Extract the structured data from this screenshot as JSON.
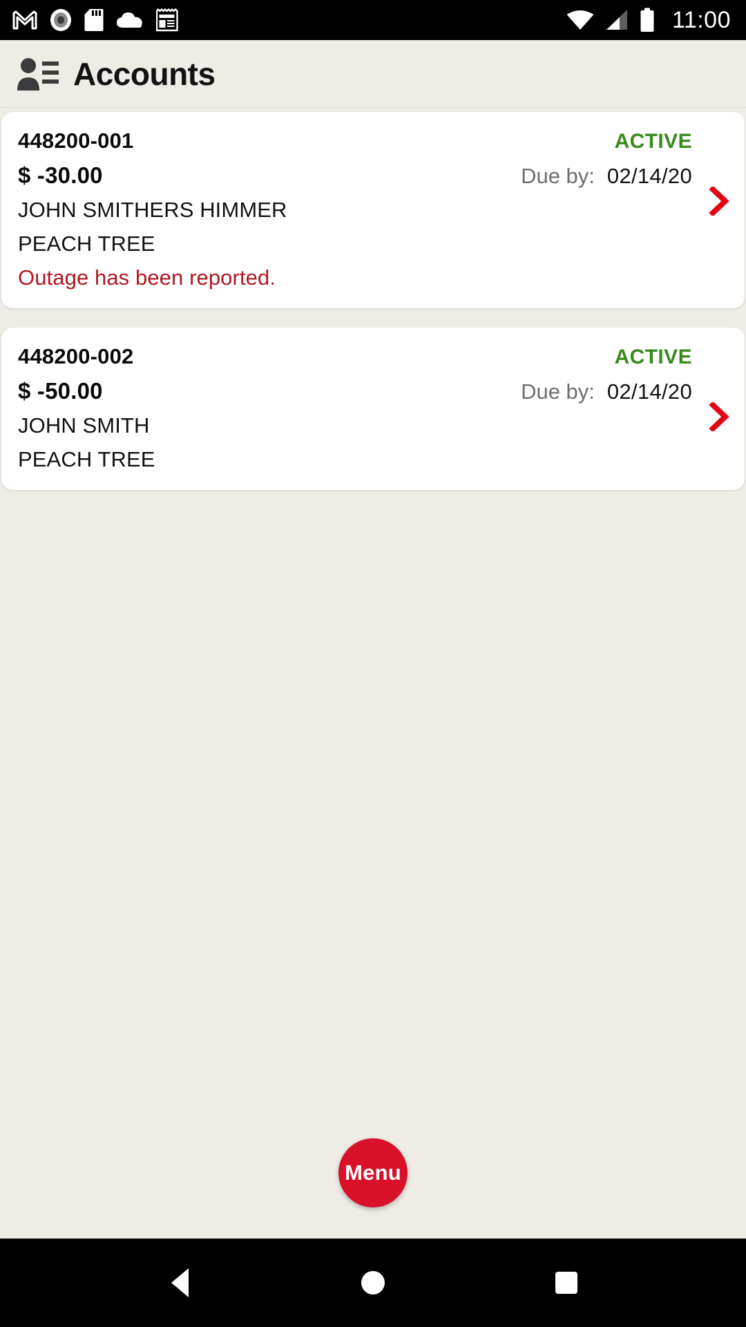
{
  "status_bar": {
    "left_icons": [
      {
        "name": "gmail-icon",
        "label": "M"
      },
      {
        "name": "record-icon",
        "label": "record"
      },
      {
        "name": "sd-card-icon",
        "label": "sd card"
      },
      {
        "name": "cloud-icon",
        "label": "cloud"
      },
      {
        "name": "news-icon",
        "label": "news"
      }
    ],
    "right_icons": [
      {
        "name": "wifi-icon",
        "label": "wifi"
      },
      {
        "name": "cellular-signal-icon",
        "label": "signal"
      },
      {
        "name": "battery-icon",
        "label": "battery"
      }
    ],
    "clock": "11:00"
  },
  "header": {
    "icon": "accounts-icon",
    "title": "Accounts"
  },
  "accounts": [
    {
      "number": "448200-001",
      "status": "ACTIVE",
      "amount": "$ -30.00",
      "due_label": "Due by:",
      "due_date": "02/14/20",
      "customer_name": "JOHN SMITHERS HIMMER",
      "address": "PEACH TREE",
      "alert": "Outage has been reported.",
      "chevron": "chevron-right-icon"
    },
    {
      "number": "448200-002",
      "status": "ACTIVE",
      "amount": "$ -50.00",
      "due_label": "Due by:",
      "due_date": "02/14/20",
      "customer_name": "JOHN SMITH",
      "address": "PEACH TREE",
      "alert": "",
      "chevron": "chevron-right-icon"
    }
  ],
  "fab": {
    "label": "Menu"
  },
  "nav_bar": {
    "back": "back-button",
    "home": "home-button",
    "recents": "recents-button"
  },
  "colors": {
    "background": "#EFEBE5",
    "card": "#FFFFFF",
    "status_active": "#3A8A1C",
    "alert_red": "#B01820",
    "accent_red": "#D81128",
    "chevron_red": "#E30613",
    "muted_text": "#6E6E6E"
  }
}
